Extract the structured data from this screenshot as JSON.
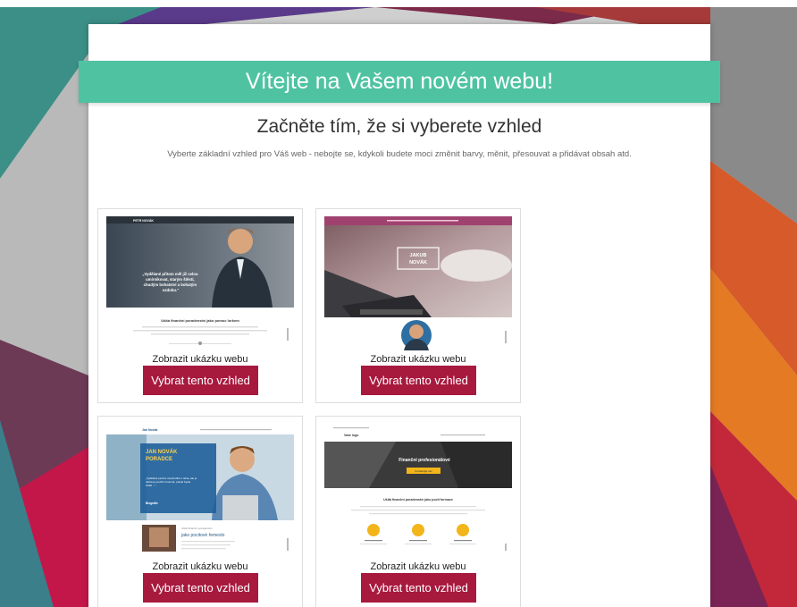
{
  "banner": {
    "title": "Vítejte na Vašem novém webu!"
  },
  "header": {
    "title": "Začněte tím, že si vyberete vzhled",
    "subtitle": "Vyberte základní vzhled pro Váš web - nebojte se, kdykoli budete moci změnit barvy, měnit, přesouvat a přidávat obsah atd."
  },
  "templates": [
    {
      "demo_label": "Zobrazit ukázku webu",
      "select_label": "Vybrat tento vzhled",
      "preview": {
        "brand": "PETR NOVÁK",
        "quote": "„Vydělané přitom měl již celou umírnikovat, starým štěstí, chudým bohatství a bohatým ozdobu.\"",
        "section_title": "Ušitá finanční poradenství jako pomoc lorkem"
      }
    },
    {
      "demo_label": "Zobrazit ukázku webu",
      "select_label": "Vybrat tento vzhled",
      "preview": {
        "hero_text_1": "JAKUB",
        "hero_text_2": "NOVÁK"
      }
    },
    {
      "demo_label": "Zobrazit ukázku webu",
      "select_label": "Vybrat tento vzhled",
      "preview": {
        "brand": "Jan Novák",
        "name_line_1": "JAN NOVÁK",
        "name_line_2": "PORADCE",
        "quote": "„Vydělané peníze nevyhodíte z okna, ale je dobré je použít rozumně, pokud byste chtěli ...\"",
        "signature": "Biografie",
        "section_small": "Ušitá finanční poradenství",
        "section_title": "jako pocitové řemeslo"
      }
    },
    {
      "demo_label": "Zobrazit ukázku webu",
      "select_label": "Vybrat tento vzhled",
      "preview": {
        "brand": "Vaše logo",
        "hero_title": "Finanční profesionálové",
        "hero_button": "Kontaktujte nás",
        "section_title": "Ušitá finanční poradenství jako pocit formace"
      }
    }
  ],
  "colors": {
    "banner": "#4fc3a1",
    "button": "#a8193e",
    "panel": "#ffffff"
  }
}
